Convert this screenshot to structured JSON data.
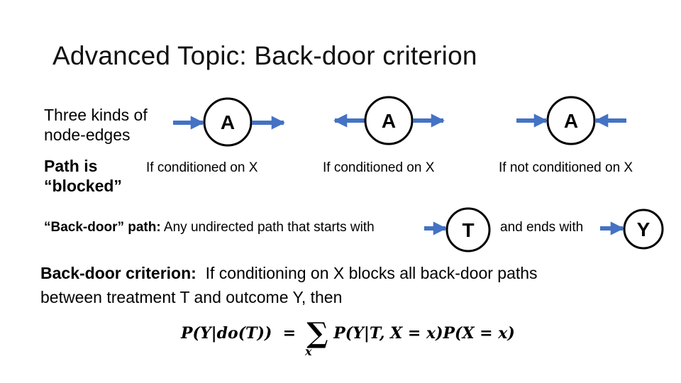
{
  "slide": {
    "title": "Advanced Topic: Back-door criterion",
    "intro": {
      "line1": "Three kinds of",
      "line2": "node-edges",
      "blocked_line1": "Path is",
      "blocked_line2": "“blocked”"
    },
    "node_edges": [
      {
        "node": "A",
        "type": "chain",
        "condition": "If conditioned on X"
      },
      {
        "node": "A",
        "type": "fork",
        "condition": "If conditioned on X"
      },
      {
        "node": "A",
        "type": "collider",
        "condition": "If not conditioned on X"
      }
    ],
    "backdoor_path": {
      "label": "“Back-door” path:",
      "text": "Any undirected path that starts with",
      "start_node": "T",
      "middle_text": "and ends with",
      "end_node": "Y"
    },
    "criterion": {
      "label": "Back-door criterion:",
      "text1": "If conditioning on X blocks all back-door paths",
      "text2": "between treatment T and outcome Y, then"
    },
    "formula": {
      "lhs": "P(Y|do(T))",
      "equals": "=",
      "sum_symbol": "∑",
      "sum_index": "x",
      "rhs": "P(Y|T, X = x)P(X = x)"
    },
    "colors": {
      "arrow": "#4472C4",
      "node_stroke": "#000000",
      "text": "#000000"
    }
  }
}
